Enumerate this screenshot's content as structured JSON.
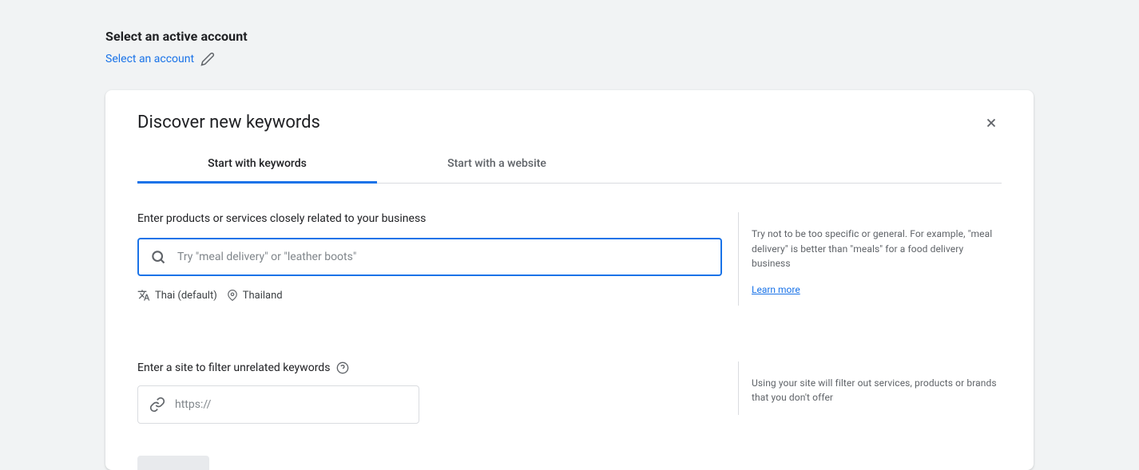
{
  "header": {
    "title": "Select an active account",
    "select_link": "Select an account"
  },
  "card": {
    "title": "Discover new keywords",
    "tabs": [
      {
        "label": "Start with keywords"
      },
      {
        "label": "Start with a website"
      }
    ]
  },
  "keywords_section": {
    "label": "Enter products or services closely related to your business",
    "placeholder": "Try \"meal delivery\" or \"leather boots\"",
    "language": "Thai (default)",
    "location": "Thailand",
    "help_text": "Try not to be too specific or general. For example, \"meal delivery\" is better than \"meals\" for a food delivery business",
    "learn_more": "Learn more"
  },
  "site_section": {
    "label": "Enter a site to filter unrelated keywords",
    "placeholder": "https://",
    "help_text": "Using your site will filter out services, products or brands that you don't offer"
  }
}
